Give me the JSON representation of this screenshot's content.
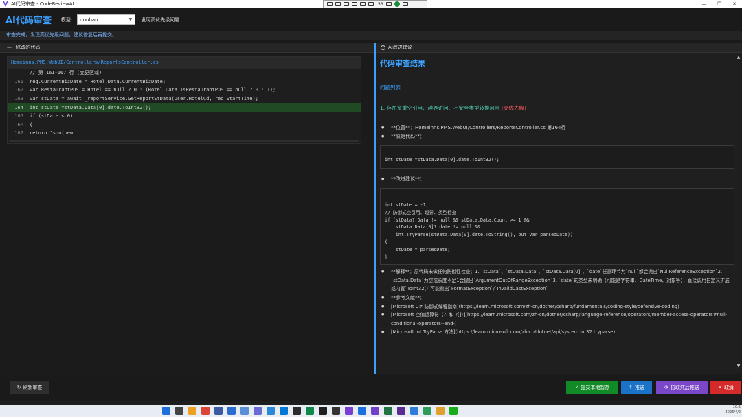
{
  "window": {
    "title": "AI代码审查 - CodeReviewAI",
    "controls": [
      "—",
      "❐",
      "✕"
    ]
  },
  "recording_toolbar": {
    "count": "53"
  },
  "header": {
    "app_name": "AI代码审查",
    "model_label": "模型:",
    "model_value": "doubao",
    "find_issues_label": "发现高优先级问题"
  },
  "status": {
    "message": "审查完成，发现高优先级问题，建议修复后再提交。"
  },
  "left_panel": {
    "title": "修改的代码",
    "file_path": "Homeinns.PMS.WebUI/Controllers/ReportsController.cs",
    "lines": [
      {
        "num": "",
        "text": "// 第 161-167 行 (变更区域)",
        "highlight": false
      },
      {
        "num": "161",
        "text": "req.CurrentBizDate = Hotel.Data.CurrentBizDate;",
        "highlight": false
      },
      {
        "num": "162",
        "text": "var RestaurantPOS = Hotel == null ? 0 : (Hotel.Data.IsRestaurantPOS == null ? 0 : 1);",
        "highlight": false
      },
      {
        "num": "163",
        "text": "var stData = await _reportService.GetReportStData(user.HotelCd, req.StartTime);",
        "highlight": false
      },
      {
        "num": "164",
        "text": "int stDate =stData.Data[0].date.ToInt32();",
        "highlight": true
      },
      {
        "num": "165",
        "text": "if (stDate < 0)",
        "highlight": false
      },
      {
        "num": "166",
        "text": "{",
        "highlight": false
      },
      {
        "num": "167",
        "text": "return Json(new",
        "highlight": false
      }
    ]
  },
  "right_panel": {
    "title": "AI改进建议",
    "heading": "代码审查结果",
    "issues_heading": "问题列表",
    "issue_title": "1. 存在多重空引用、越界访问、不安全类型转换风险 ",
    "issue_priority": "[高优先级]",
    "location": "**位置**：Homeinns.PMS.WebUI/Controllers/ReportsController.cs 第164行",
    "original_code_label": "**原始代码**：",
    "original_code": "int stDate =stData.Data[0].date.ToInt32();",
    "suggestion_label": "**改进建议**：",
    "suggested_code": "int stDate = -1;\n// 防御式空引用、越界、类型检查\nif (stData?.Data != null && stData.Data.Count >= 1 &&\n    stData.Data[0]?.date != null &&\n    int.TryParse(stData.Data[0].date.ToString(), out var parsedDate))\n{\n    stDate = parsedDate;\n}",
    "explanation": "**解释**：原代码未做任何防御性检查：1. `stData`、`stData.Data`、`stData.Data[0]`、`date`任意环节为`null`都会抛出`NullReferenceException`2. `stData.Data`为空或长度不足1会抛出`ArgumentOutOfRangeException`3. `date`的类型未明确（可能是字符串、DateTime、对象等），直接调用自定义扩展或内置`ToInt32()`可能抛出`FormatException`/`InvalidCastException`",
    "references_label": "**参考文献**：",
    "references": [
      "[Microsoft C# 防御式编程指南](https://learn.microsoft.com/zh-cn/dotnet/csharp/fundamentals/coding-style/defensive-coding)",
      "[Microsoft 空值运算符（?. 和 ?[]）](https://learn.microsoft.com/zh-cn/dotnet/csharp/language-reference/operators/member-access-operators#null-conditional-operators--and-)",
      "[Microsoft int.TryParse 方法](https://learn.microsoft.com/zh-cn/dotnet/api/system.int32.tryparse)"
    ]
  },
  "footer": {
    "refresh_label": "刷新审查",
    "save_label": "提交本地暂存",
    "push_label": "推送",
    "pull_push_label": "拉取然后推送",
    "cancel_label": "取消"
  },
  "taskbar": {
    "clock_time": "10:5",
    "clock_date": "2026/4/2",
    "icon_colors": [
      "#1e6fd9",
      "#444444",
      "#f0a020",
      "#db4437",
      "#3b5aa0",
      "#2b6ccf",
      "#5a8fd8",
      "#6b6bd6",
      "#2a88d8",
      "#0078d4",
      "#2c2c2c",
      "#0d8a4a",
      "#1f1f1f",
      "#333333",
      "#7a3fd0",
      "#1b6fe0",
      "#7040c8",
      "#217346",
      "#5c2d91",
      "#2e7dd8",
      "#2f9b5c",
      "#e0a030",
      "#1aad19"
    ]
  }
}
